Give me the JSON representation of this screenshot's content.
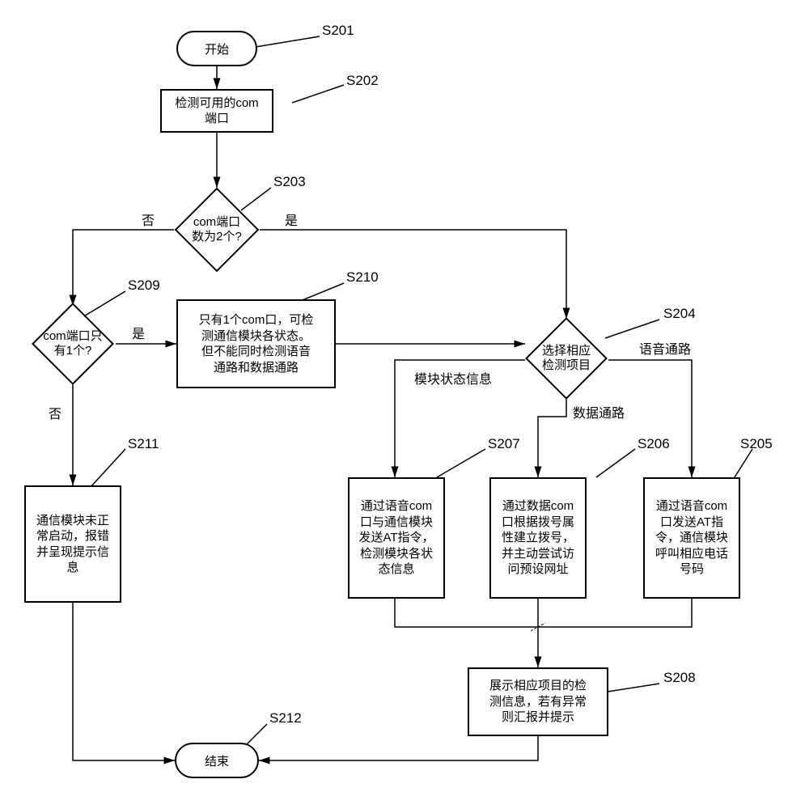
{
  "nodes": {
    "start": {
      "text": "开始"
    },
    "detect": {
      "text": "检测可用的com\n端口"
    },
    "q2": {
      "text": "com端口\n数为2个?"
    },
    "q1": {
      "text": "com端口只\n有1个?"
    },
    "only1": {
      "text": "只有1个com口，可检\n测通信模块各状态。\n但不能同时检测语音\n通路和数据通路"
    },
    "select": {
      "text": "选择相应\n检测项目"
    },
    "voice": {
      "text": "通过语音com\n口发送AT指\n令，通信模块\n呼叫相应电话\n号码"
    },
    "data": {
      "text": "通过数据com\n口根据拨号属\n性建立拨号，\n并主动尝试访\n问预设网址"
    },
    "status": {
      "text": "通过语音com\n口与通信模块\n发送AT指令，\n检测模块各状\n态信息"
    },
    "show": {
      "text": "展示相应项目的检\n测信息，若有异常\n则汇报并提示"
    },
    "fail": {
      "text": "通信模块未正\n常启动，报错\n并呈现提示信\n息"
    },
    "end": {
      "text": "结束"
    }
  },
  "steplabels": {
    "s201": "S201",
    "s202": "S202",
    "s203": "S203",
    "s204": "S204",
    "s205": "S205",
    "s206": "S206",
    "s207": "S207",
    "s208": "S208",
    "s209": "S209",
    "s210": "S210",
    "s211": "S211",
    "s212": "S212"
  },
  "edgelabels": {
    "q2_yes": "是",
    "q2_no": "否",
    "q1_yes": "是",
    "q1_no": "否",
    "sel_status": "模块状态信息",
    "sel_data": "数据通路",
    "sel_voice": "语音通路"
  },
  "chart_data": {
    "type": "flowchart",
    "nodes": [
      {
        "id": "S201",
        "shape": "terminator",
        "text": "开始"
      },
      {
        "id": "S202",
        "shape": "process",
        "text": "检测可用的com端口"
      },
      {
        "id": "S203",
        "shape": "decision",
        "text": "com端口数为2个?"
      },
      {
        "id": "S204",
        "shape": "decision",
        "text": "选择相应检测项目"
      },
      {
        "id": "S205",
        "shape": "process",
        "text": "通过语音com口发送AT指令，通信模块呼叫相应电话号码"
      },
      {
        "id": "S206",
        "shape": "process",
        "text": "通过数据com口根据拨号属性建立拨号，并主动尝试访问预设网址"
      },
      {
        "id": "S207",
        "shape": "process",
        "text": "通过语音com口与通信模块发送AT指令，检测模块各状态信息"
      },
      {
        "id": "S208",
        "shape": "process",
        "text": "展示相应项目的检测信息，若有异常则汇报并提示"
      },
      {
        "id": "S209",
        "shape": "decision",
        "text": "com端口只有1个?"
      },
      {
        "id": "S210",
        "shape": "process",
        "text": "只有1个com口，可检测通信模块各状态。但不能同时检测语音通路和数据通路"
      },
      {
        "id": "S211",
        "shape": "process",
        "text": "通信模块未正常启动，报错并呈现提示信息"
      },
      {
        "id": "S212",
        "shape": "terminator",
        "text": "结束"
      }
    ],
    "edges": [
      {
        "from": "S201",
        "to": "S202"
      },
      {
        "from": "S202",
        "to": "S203"
      },
      {
        "from": "S203",
        "to": "S204",
        "label": "是"
      },
      {
        "from": "S203",
        "to": "S209",
        "label": "否"
      },
      {
        "from": "S209",
        "to": "S210",
        "label": "是"
      },
      {
        "from": "S209",
        "to": "S211",
        "label": "否"
      },
      {
        "from": "S210",
        "to": "S204"
      },
      {
        "from": "S204",
        "to": "S205",
        "label": "语音通路"
      },
      {
        "from": "S204",
        "to": "S206",
        "label": "数据通路"
      },
      {
        "from": "S204",
        "to": "S207",
        "label": "模块状态信息"
      },
      {
        "from": "S205",
        "to": "S208"
      },
      {
        "from": "S206",
        "to": "S208"
      },
      {
        "from": "S207",
        "to": "S208"
      },
      {
        "from": "S208",
        "to": "S212"
      },
      {
        "from": "S211",
        "to": "S212"
      }
    ]
  }
}
